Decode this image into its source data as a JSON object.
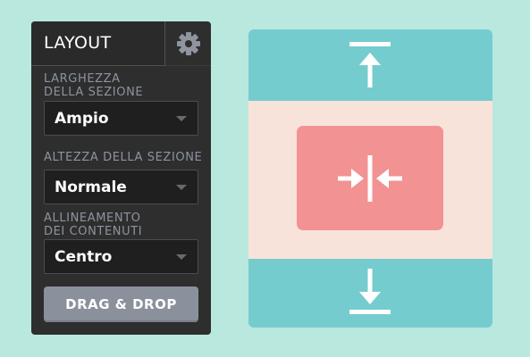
{
  "panel": {
    "tab_label": "LAYOUT",
    "settings_icon": "gear-icon",
    "fields": {
      "width": {
        "label_line1": "LARGHEZZA",
        "label_line2": "DELLA SEZIONE",
        "value": "Ampio"
      },
      "height": {
        "label": "ALTEZZA DELLA SEZIONE",
        "value": "Normale"
      },
      "alignment": {
        "label_line1": "ALLINEAMENTO",
        "label_line2": "DEI CONTENUTI",
        "value": "Centro"
      }
    },
    "drag_drop_label": "DRAG & DROP"
  },
  "preview": {
    "icons": {
      "top": "expand-up-arrow-icon",
      "center": "align-center-arrows-icon",
      "bottom": "expand-down-arrow-icon"
    }
  },
  "colors": {
    "background": "#b9e8de",
    "panel": "#2e2e2e",
    "teal_band": "#75ccce",
    "peach_band": "#f8e3da",
    "center_box": "#f29292",
    "button": "#8a919c"
  }
}
